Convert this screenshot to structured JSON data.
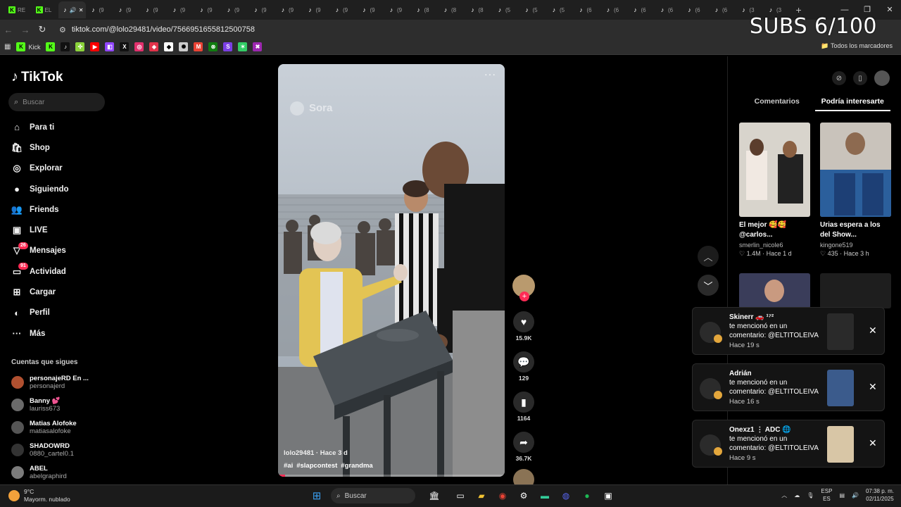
{
  "browser": {
    "tabs": [
      {
        "label": "RE",
        "kind": "kick"
      },
      {
        "label": "EL",
        "kind": "kick"
      },
      {
        "label": "",
        "kind": "tiktok-active"
      },
      {
        "label": "(9",
        "kind": "tiktok"
      },
      {
        "label": "(9",
        "kind": "tiktok"
      },
      {
        "label": "(9",
        "kind": "tiktok"
      },
      {
        "label": "(9",
        "kind": "tiktok"
      },
      {
        "label": "(9",
        "kind": "tiktok"
      },
      {
        "label": "(9",
        "kind": "tiktok"
      },
      {
        "label": "(9",
        "kind": "tiktok"
      },
      {
        "label": "(9",
        "kind": "tiktok"
      },
      {
        "label": "(9",
        "kind": "tiktok"
      },
      {
        "label": "(9",
        "kind": "tiktok"
      },
      {
        "label": "(9",
        "kind": "tiktok"
      },
      {
        "label": "(9",
        "kind": "tiktok"
      },
      {
        "label": "(8",
        "kind": "tiktok"
      },
      {
        "label": "(8",
        "kind": "tiktok"
      },
      {
        "label": "(8",
        "kind": "tiktok"
      },
      {
        "label": "(5",
        "kind": "tiktok"
      },
      {
        "label": "(5",
        "kind": "tiktok"
      },
      {
        "label": "(5",
        "kind": "tiktok"
      },
      {
        "label": "(6",
        "kind": "tiktok"
      },
      {
        "label": "(6",
        "kind": "tiktok"
      },
      {
        "label": "(6",
        "kind": "tiktok"
      },
      {
        "label": "(6",
        "kind": "tiktok"
      },
      {
        "label": "(6",
        "kind": "tiktok"
      },
      {
        "label": "(6",
        "kind": "tiktok"
      },
      {
        "label": "(3",
        "kind": "tiktok"
      },
      {
        "label": "(3",
        "kind": "tiktok"
      }
    ],
    "new_tab": "+",
    "url": "tiktok.com/@lolo29481/video/7566951655812500758",
    "overlay_counter": "SUBS 6/100",
    "bookmarks": [
      {
        "label": "Kick",
        "icon": "kick-icon",
        "color": "#53fc18"
      },
      {
        "label": "",
        "icon": "kick-icon",
        "color": "#53fc18"
      },
      {
        "label": "",
        "icon": "tiktok-icon",
        "color": "#111111"
      },
      {
        "label": "",
        "icon": "clover-icon",
        "color": "#8bd33b"
      },
      {
        "label": "",
        "icon": "youtube-icon",
        "color": "#ff0000"
      },
      {
        "label": "",
        "icon": "twitch-icon",
        "color": "#9146ff"
      },
      {
        "label": "",
        "icon": "x-icon",
        "color": "#111111"
      },
      {
        "label": "",
        "icon": "instagram-icon",
        "color": "#e1306c"
      },
      {
        "label": "",
        "icon": "app-icon",
        "color": "#e2334a"
      },
      {
        "label": "",
        "icon": "diamond-icon",
        "color": "#ffffff"
      },
      {
        "label": "",
        "icon": "openai-icon",
        "color": "#cccccc"
      },
      {
        "label": "",
        "icon": "gmail-icon",
        "color": "#ea4335"
      },
      {
        "label": "",
        "icon": "xbox-icon",
        "color": "#107c10"
      },
      {
        "label": "",
        "icon": "s-icon",
        "color": "#7b3fe4"
      },
      {
        "label": "",
        "icon": "spark-icon",
        "color": "#33cc66"
      },
      {
        "label": "",
        "icon": "mascot-icon",
        "color": "#9c27b0"
      }
    ],
    "all_bookmarks": "Todos los marcadores"
  },
  "tiktok": {
    "logo": "TikTok",
    "search_placeholder": "Buscar",
    "nav": [
      {
        "label": "Para ti",
        "icon": "home-icon",
        "badge": ""
      },
      {
        "label": "Shop",
        "icon": "shop-icon",
        "badge": ""
      },
      {
        "label": "Explorar",
        "icon": "compass-icon",
        "badge": ""
      },
      {
        "label": "Siguiendo",
        "icon": "following-icon",
        "badge": ""
      },
      {
        "label": "Friends",
        "icon": "friends-icon",
        "badge": ""
      },
      {
        "label": "LIVE",
        "icon": "live-icon",
        "badge": ""
      },
      {
        "label": "Mensajes",
        "icon": "messages-icon",
        "badge": "26"
      },
      {
        "label": "Actividad",
        "icon": "activity-icon",
        "badge": "91"
      },
      {
        "label": "Cargar",
        "icon": "upload-icon",
        "badge": ""
      },
      {
        "label": "Perfil",
        "icon": "profile-icon",
        "badge": ""
      },
      {
        "label": "Más",
        "icon": "more-icon",
        "badge": ""
      }
    ],
    "following_header": "Cuentas que sigues",
    "following": [
      {
        "name": "personajeRD En ...",
        "handle": "personajerd"
      },
      {
        "name": "Banny 💕",
        "handle": "lauriss673"
      },
      {
        "name": "Matias  Alofoke",
        "handle": "matiasalofoke"
      },
      {
        "name": "SHADOWRD",
        "handle": "0880_cartel0.1"
      },
      {
        "name": "ABEL",
        "handle": "abelgraphird"
      }
    ]
  },
  "video": {
    "watermark": "Sora",
    "author_line": "lolo29481 · Hace 3 d",
    "hashtags": [
      "#ai",
      "#slapcontest",
      "#grandma"
    ],
    "progress": 0.03,
    "likes": "15.9K",
    "comments": "129",
    "saves": "1164",
    "shares": "36.7K"
  },
  "right_panel": {
    "tabs": [
      "Comentarios",
      "Podría interesarte"
    ],
    "active_tab": 1,
    "cards": [
      {
        "title": "El mejor 🥰🥰 @carlos...",
        "author": "smerlin_nicole6",
        "likes": "♡ 1.4M",
        "age": "Hace 1 d"
      },
      {
        "title": "Urias espera a los del Show...",
        "author": "kingone519",
        "likes": "♡ 435",
        "age": "Hace 3 h"
      }
    ]
  },
  "notifications": [
    {
      "who": "Skinerr 🚗 ¹⁷²",
      "msg": "te mencionó en un comentario: @ELTITOLEIVA",
      "time": "Hace 19 s"
    },
    {
      "who": "Adrián",
      "msg": "te mencionó en un comentario: @ELTITOLEIVA",
      "time": "Hace 16 s"
    },
    {
      "who": "Onexz1 ⋮ ADC 🌐",
      "msg": "te mencionó en un comentario: @ELTITOLEIVA",
      "time": "Hace 9 s"
    }
  ],
  "taskbar": {
    "temp": "9°C",
    "weather": "Mayorm. nublado",
    "search": "Buscar",
    "lang": "ESP",
    "lang_sub": "ES",
    "time": "07:38 p. m.",
    "date": "02/11/2025"
  }
}
